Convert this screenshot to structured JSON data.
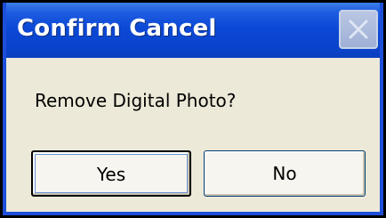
{
  "window": {
    "title": "Confirm Cancel",
    "close_icon": "close-icon"
  },
  "dialog": {
    "message": "Remove Digital Photo?"
  },
  "buttons": {
    "yes_label": "Yes",
    "no_label": "No"
  },
  "colors": {
    "titlebar": "#0a43cc",
    "frame": "#1d4fd8",
    "dialog_bg": "#ece9d8",
    "close_button": "#9fb0d6",
    "title_text": "#ffffff"
  }
}
